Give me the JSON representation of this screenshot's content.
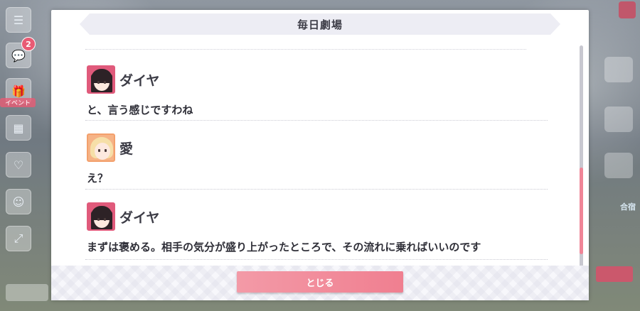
{
  "dialog": {
    "title": "毎日劇場",
    "entries": [
      {
        "speaker": "ダイヤ",
        "avatar": "dia-portrait",
        "text": "と、言う感じですわね"
      },
      {
        "speaker": "愛",
        "avatar": "ai-portrait",
        "text": "え？"
      },
      {
        "speaker": "ダイヤ",
        "avatar": "dia-portrait",
        "text": "まずは褒める。相手の気分が盛り上がったところで、その流れに乗ればいいのです"
      }
    ],
    "close_label": "とじる"
  },
  "left_menu": {
    "badge_count": "2",
    "event_label": "イベント"
  },
  "right_menu": {
    "label": "合宿"
  },
  "colors": {
    "accent": "#f07f90",
    "scroll_thumb": "#f08597",
    "title_bar": "#ededf4"
  }
}
